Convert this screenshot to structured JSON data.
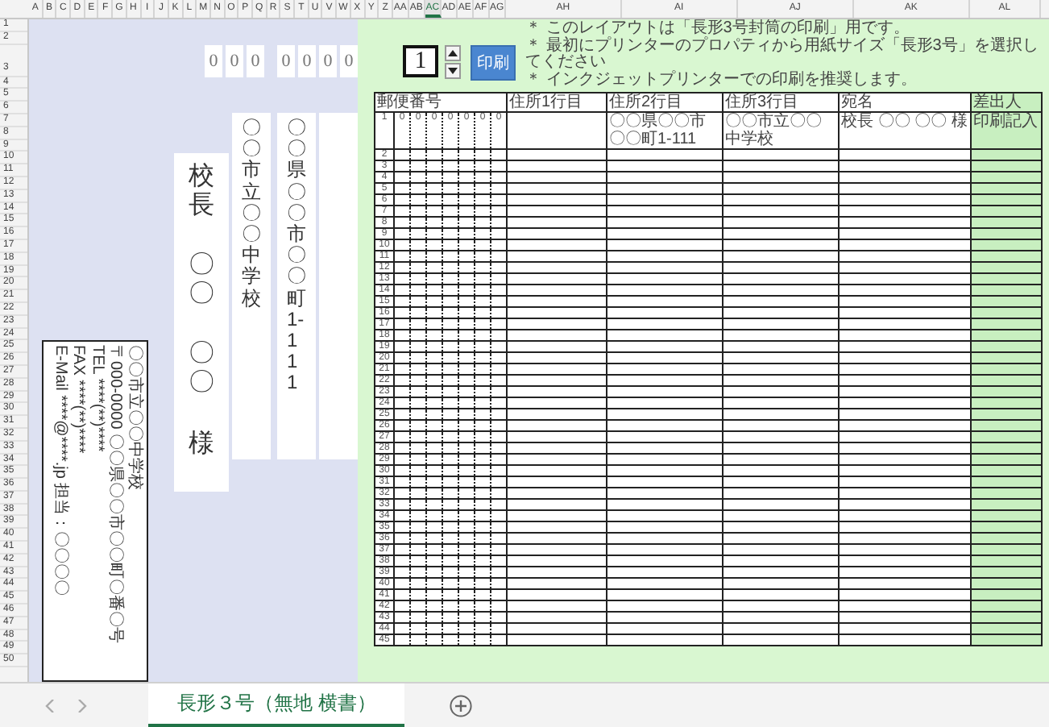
{
  "sheet": {
    "columns": [
      {
        "label": "A",
        "selected": false
      },
      {
        "label": "B",
        "selected": false
      },
      {
        "label": "C",
        "selected": false
      },
      {
        "label": "D",
        "selected": false
      },
      {
        "label": "E",
        "selected": false
      },
      {
        "label": "F",
        "selected": false
      },
      {
        "label": "G",
        "selected": false
      },
      {
        "label": "H",
        "selected": false
      },
      {
        "label": "I",
        "selected": false
      },
      {
        "label": "J",
        "selected": false
      },
      {
        "label": "K",
        "selected": false
      },
      {
        "label": "L",
        "selected": false
      },
      {
        "label": "M",
        "selected": false
      },
      {
        "label": "N",
        "selected": false
      },
      {
        "label": "O",
        "selected": false
      },
      {
        "label": "P",
        "selected": false
      },
      {
        "label": "Q",
        "selected": false
      },
      {
        "label": "R",
        "selected": false
      },
      {
        "label": "S",
        "selected": false
      },
      {
        "label": "T",
        "selected": false
      },
      {
        "label": "U",
        "selected": false
      },
      {
        "label": "V",
        "selected": false
      },
      {
        "label": "W",
        "selected": false
      },
      {
        "label": "X",
        "selected": false
      },
      {
        "label": "Y",
        "selected": false
      },
      {
        "label": "Z",
        "selected": false
      },
      {
        "label": "AA",
        "selected": false
      },
      {
        "label": "AB",
        "selected": false
      },
      {
        "label": "AC",
        "selected": true
      },
      {
        "label": "AD",
        "selected": false
      },
      {
        "label": "AE",
        "selected": false
      },
      {
        "label": "AF",
        "selected": false
      },
      {
        "label": "AG",
        "selected": false
      },
      {
        "label": "AH",
        "selected": false
      },
      {
        "label": "AI",
        "selected": false
      },
      {
        "label": "AJ",
        "selected": false
      },
      {
        "label": "AK",
        "selected": false
      },
      {
        "label": "AL",
        "selected": false
      }
    ],
    "rows": [
      "1",
      "2",
      "3",
      "4",
      "5",
      "6",
      "7",
      "8",
      "9",
      "10",
      "11",
      "12",
      "13",
      "14",
      "15",
      "16",
      "17",
      "18",
      "19",
      "20",
      "21",
      "22",
      "23",
      "24",
      "25",
      "26",
      "27",
      "28",
      "29",
      "30",
      "31",
      "32",
      "33",
      "34",
      "35",
      "36",
      "37",
      "38",
      "39",
      "40",
      "41",
      "42",
      "43",
      "44",
      "45",
      "46",
      "47",
      "48",
      "49",
      "50"
    ]
  },
  "envelope": {
    "postal_code": [
      "0",
      "0",
      "0",
      "0",
      "0",
      "0",
      "0"
    ],
    "recipient": [
      "校長",
      "〇〇",
      "〇〇",
      "様"
    ],
    "address_line_3": "〇〇市立〇〇中学校",
    "address_line_2": "〇〇県〇〇市〇〇町1-111",
    "sender": [
      "〇〇市立〇〇中学校",
      "〒000-0000 〇〇県〇〇市〇〇町〇番〇号",
      "TEL ****(**)****",
      "FAX ****(**)****",
      "E-Mail ****@****.jp 担当：〇〇〇〇"
    ]
  },
  "controls": {
    "spinner_value": "1",
    "print_button": "印刷",
    "notes": [
      "＊ このレイアウトは「長形3号封筒の印刷」用です。",
      "＊ 最初にプリンターのプロパティから用紙サイズ「長形3号」を選択してください",
      "＊ インクジェットプリンターでの印刷を推奨します。"
    ]
  },
  "table": {
    "columns": [
      "郵便番号",
      "住所1行目",
      "住所2行目",
      "住所3行目",
      "宛名",
      "差出人"
    ],
    "first_row": {
      "number": "1",
      "postal": [
        "0",
        "0",
        "0",
        "0",
        "0",
        "0",
        "0"
      ],
      "address_2": "〇〇県〇〇市〇〇町1-111",
      "address_3": "〇〇市立〇〇中学校",
      "recipient": "校長 〇〇 〇〇 様",
      "sender": "印刷記入"
    },
    "row_numbers": [
      "2",
      "3",
      "4",
      "5",
      "6",
      "7",
      "8",
      "9",
      "10",
      "11",
      "12",
      "13",
      "14",
      "15",
      "16",
      "17",
      "18",
      "19",
      "20",
      "21",
      "22",
      "23",
      "24",
      "25",
      "26",
      "27",
      "28",
      "29",
      "30",
      "31",
      "32",
      "33",
      "34",
      "35",
      "36",
      "37",
      "38",
      "39",
      "40",
      "41",
      "42",
      "43",
      "44",
      "45"
    ]
  },
  "sheet_tabs": [
    {
      "label": "長形３号（無地 横書）",
      "selected": true
    }
  ]
}
